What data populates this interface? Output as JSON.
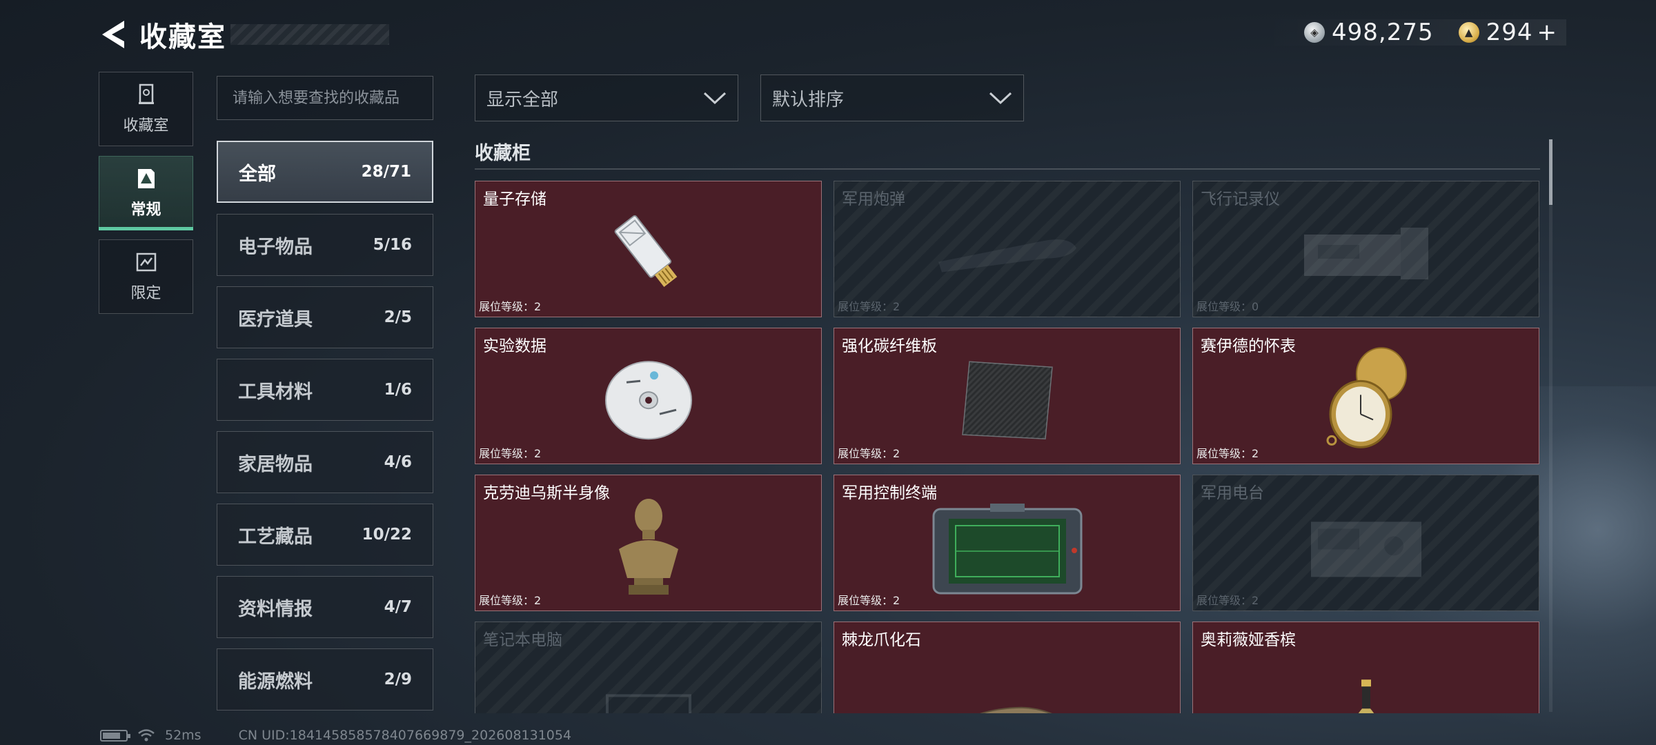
{
  "header": {
    "title": "收藏室",
    "currency": [
      {
        "icon": "silver-coin-icon",
        "value": "498,275"
      },
      {
        "icon": "gold-coin-icon",
        "value": "294",
        "plus": "+"
      }
    ]
  },
  "nav": [
    {
      "label": "收藏室",
      "icon": "collection-room-icon",
      "active": false
    },
    {
      "label": "常规",
      "icon": "regular-icon",
      "active": true
    },
    {
      "label": "限定",
      "icon": "limited-icon",
      "active": false
    }
  ],
  "search": {
    "placeholder": "请输入想要查找的收藏品"
  },
  "categories": [
    {
      "label": "全部",
      "count": "28/71",
      "active": true
    },
    {
      "label": "电子物品",
      "count": "5/16"
    },
    {
      "label": "医疗道具",
      "count": "2/5"
    },
    {
      "label": "工具材料",
      "count": "1/6"
    },
    {
      "label": "家居物品",
      "count": "4/6"
    },
    {
      "label": "工艺藏品",
      "count": "10/22"
    },
    {
      "label": "资料情报",
      "count": "4/7"
    },
    {
      "label": "能源燃料",
      "count": "2/9"
    }
  ],
  "filters": {
    "show": "显示全部",
    "sort": "默认排序"
  },
  "cabinet": {
    "title": "收藏柜",
    "items": [
      {
        "name": "量子存储",
        "level": "展位等级：2",
        "owned": true,
        "art": "usb-drive"
      },
      {
        "name": "军用炮弹",
        "level": "展位等级：2",
        "owned": false,
        "art": "shell"
      },
      {
        "name": "飞行记录仪",
        "level": "展位等级：0",
        "owned": false,
        "art": "recorder"
      },
      {
        "name": "实验数据",
        "level": "展位等级：2",
        "owned": true,
        "art": "disc"
      },
      {
        "name": "强化碳纤维板",
        "level": "展位等级：2",
        "owned": true,
        "art": "carbon-plate"
      },
      {
        "name": "赛伊德的怀表",
        "level": "展位等级：2",
        "owned": true,
        "art": "pocket-watch"
      },
      {
        "name": "克劳迪乌斯半身像",
        "level": "展位等级：2",
        "owned": true,
        "art": "bust"
      },
      {
        "name": "军用控制终端",
        "level": "展位等级：2",
        "owned": true,
        "art": "terminal"
      },
      {
        "name": "军用电台",
        "level": "展位等级：2",
        "owned": false,
        "art": "radio"
      },
      {
        "name": "笔记本电脑",
        "level": "",
        "owned": false,
        "art": "laptop"
      },
      {
        "name": "棘龙爪化石",
        "level": "",
        "owned": true,
        "art": "claw"
      },
      {
        "name": "奥莉薇娅香槟",
        "level": "",
        "owned": true,
        "art": "champagne"
      }
    ]
  },
  "status": {
    "ping": "52ms",
    "uid": "CN UID:184145858578407669879_202608131054"
  },
  "colors": {
    "owned_card": "#4a1e27",
    "locked_card": "#1e262e",
    "accent": "#5fc9a2"
  }
}
